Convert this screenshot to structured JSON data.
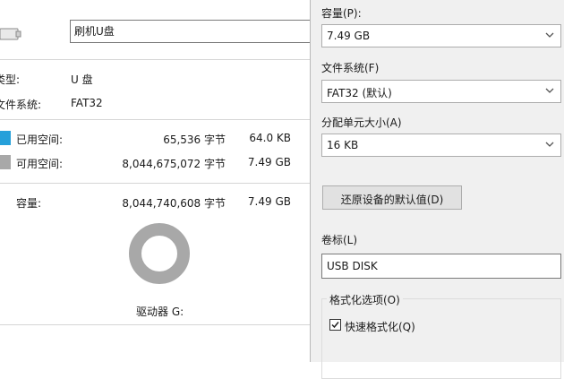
{
  "general": {
    "drive_name": "刷机U盘",
    "type_label": "类型:",
    "type_value": "U 盘",
    "fs_label": "文件系统:",
    "fs_value": "FAT32",
    "used_label": "已用空间:",
    "used_bytes": "65,536 字节",
    "used_size": "64.0 KB",
    "free_label": "可用空间:",
    "free_bytes": "8,044,675,072 字节",
    "free_size": "7.49 GB",
    "capacity_label": "容量:",
    "capacity_bytes": "8,044,740,608 字节",
    "capacity_size": "7.49 GB",
    "drive_letter": "驱动器 G:",
    "used_fraction": 8.1e-06,
    "colors": {
      "used": "#26a0da",
      "free": "#a8a8a8"
    }
  },
  "format": {
    "capacity_label": "容量(P):",
    "capacity_value": "7.49 GB",
    "filesystem_label": "文件系统(F)",
    "filesystem_value": "FAT32 (默认)",
    "alloc_label": "分配单元大小(A)",
    "alloc_value": "16 KB",
    "restore_button": "还原设备的默认值(D)",
    "volume_label": "卷标(L)",
    "volume_value": "USB DISK",
    "options_legend": "格式化选项(O)",
    "quick_format_label": "快速格式化(Q)",
    "quick_format_checked": true
  }
}
